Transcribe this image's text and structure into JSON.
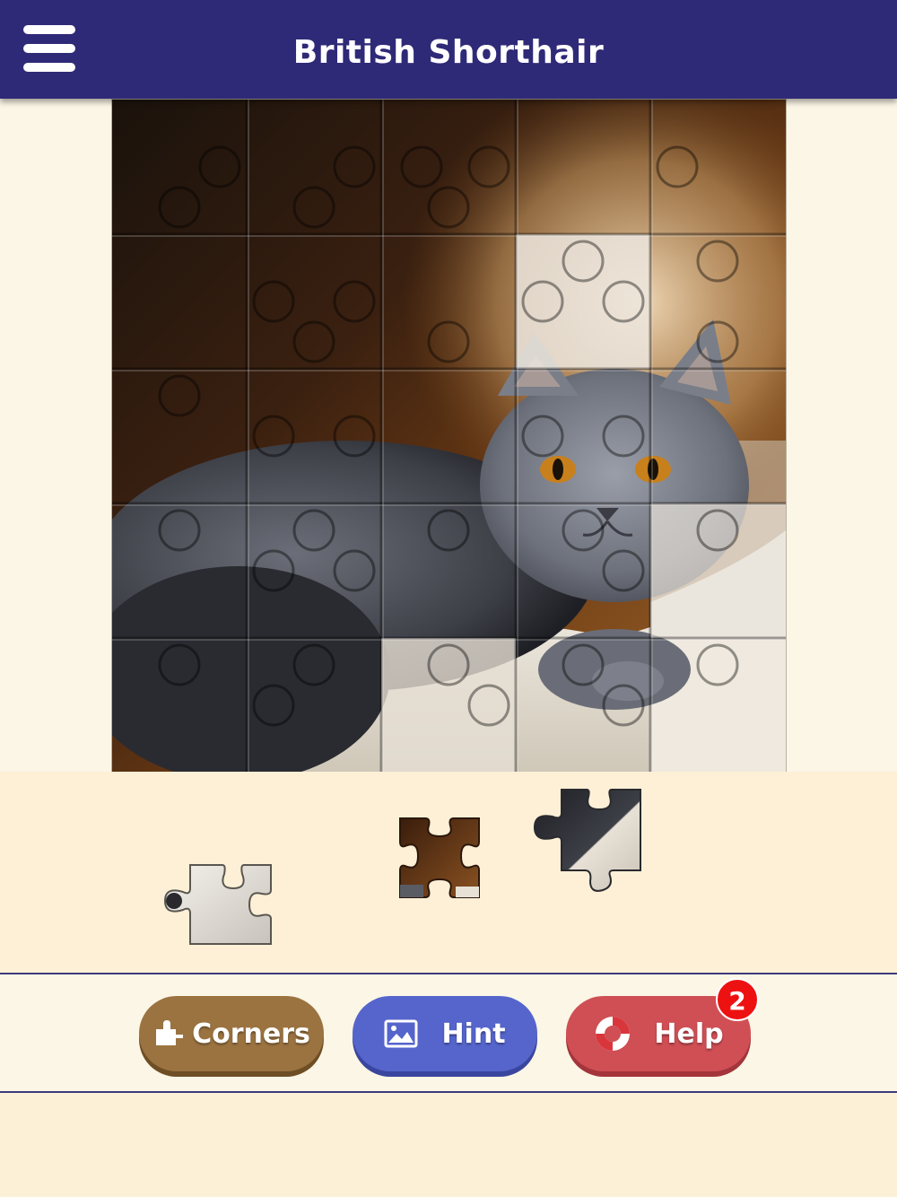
{
  "header": {
    "title": "British Shorthair",
    "menu_icon": "hamburger-menu-icon"
  },
  "buttons": {
    "corners": {
      "label": "Corners",
      "icon": "puzzle-piece-icon"
    },
    "hint": {
      "label": "Hint",
      "icon": "image-icon"
    },
    "help": {
      "label": "Help",
      "icon": "lifebuoy-icon",
      "badge": "2"
    }
  },
  "puzzle": {
    "grid": {
      "columns": 5,
      "rows": 5
    },
    "placed_pieces": 22,
    "tray_pieces": 3
  },
  "colors": {
    "header": "#2f2a77",
    "corners_button": "#9b7340",
    "hint_button": "#5565cc",
    "help_button": "#cf4f55",
    "badge": "#ee1111",
    "tray": "#fdf0d6"
  }
}
